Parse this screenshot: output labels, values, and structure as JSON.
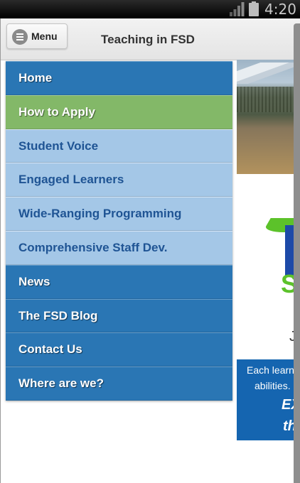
{
  "status_bar": {
    "time": "4:20",
    "signal_icon": "signal-icon",
    "battery_icon": "battery-icon"
  },
  "header": {
    "menu_label": "Menu",
    "menu_icon": "hamburger-circle-icon",
    "title": "Teaching in FSD"
  },
  "nav": {
    "items": [
      {
        "label": "Home",
        "style": "dark"
      },
      {
        "label": "How to Apply",
        "style": "active"
      },
      {
        "label": "Student Voice",
        "style": "light"
      },
      {
        "label": "Engaged Learners",
        "style": "light"
      },
      {
        "label": "Wide-Ranging Programming",
        "style": "light"
      },
      {
        "label": "Comprehensive Staff Dev.",
        "style": "light"
      },
      {
        "label": "News",
        "style": "dark"
      },
      {
        "label": "The FSD Blog",
        "style": "dark"
      },
      {
        "label": "Contact Us",
        "style": "dark"
      },
      {
        "label": "Where are we?",
        "style": "dark"
      }
    ]
  },
  "content": {
    "logo_letter_s": "S",
    "logo_letter_j": "J",
    "blue_box": {
      "line1": "Each learn",
      "line2": "abilities.",
      "line3": "EX",
      "line4": "th"
    }
  },
  "colors": {
    "nav_dark": "#2a76b4",
    "nav_active": "#83b868",
    "nav_light": "#a4c7e7",
    "nav_light_text": "#1f5494",
    "content_blue": "#1565b0",
    "logo_green": "#5cc22a"
  }
}
